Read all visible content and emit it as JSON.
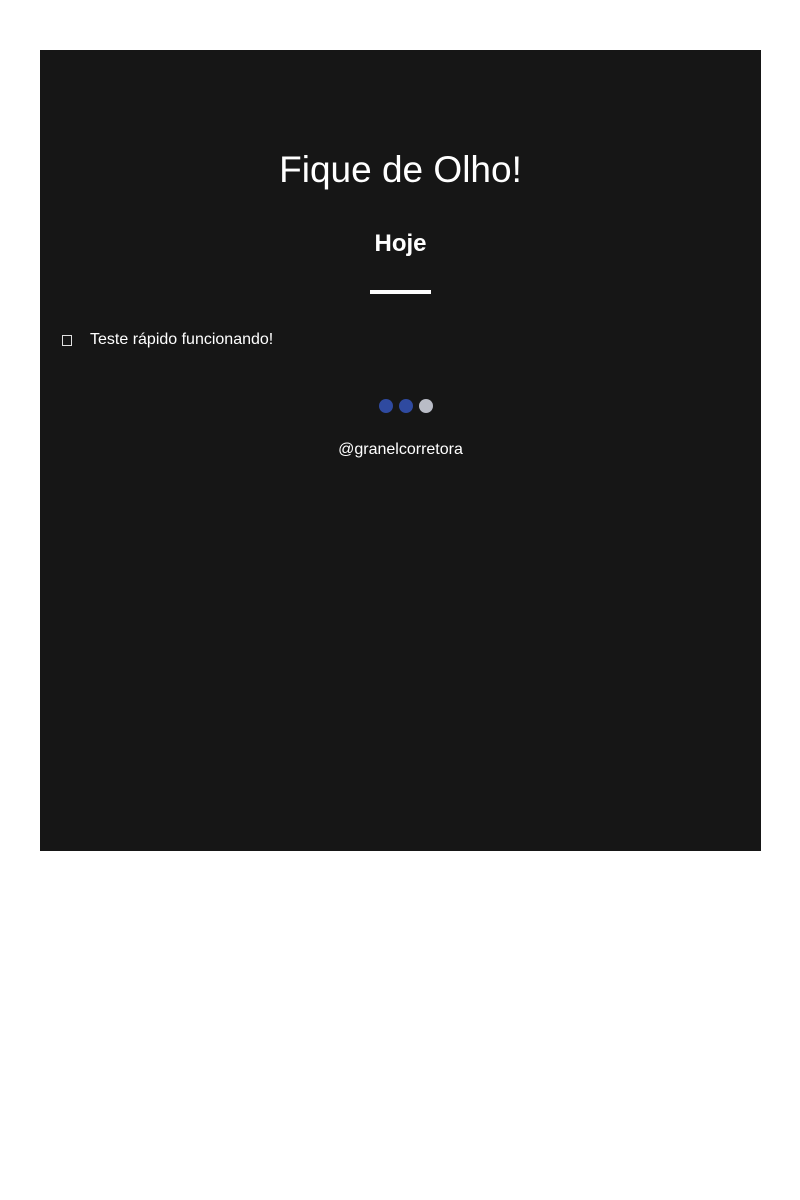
{
  "card": {
    "title": "Fique de Olho!",
    "subtitle": "Hoje",
    "items": [
      {
        "icon": "checkbox-icon",
        "text": "Teste rápido funcionando!"
      }
    ],
    "pagination": {
      "count": 3,
      "active_color": "#2f4aa0",
      "inactive_color": "#b9bcc6",
      "dots": [
        {
          "state": "active"
        },
        {
          "state": "active"
        },
        {
          "state": "inactive"
        }
      ]
    },
    "handle": "@granelcorretora"
  },
  "colors": {
    "page_background": "#ffffff",
    "card_background": "#161616",
    "text": "#ffffff"
  }
}
